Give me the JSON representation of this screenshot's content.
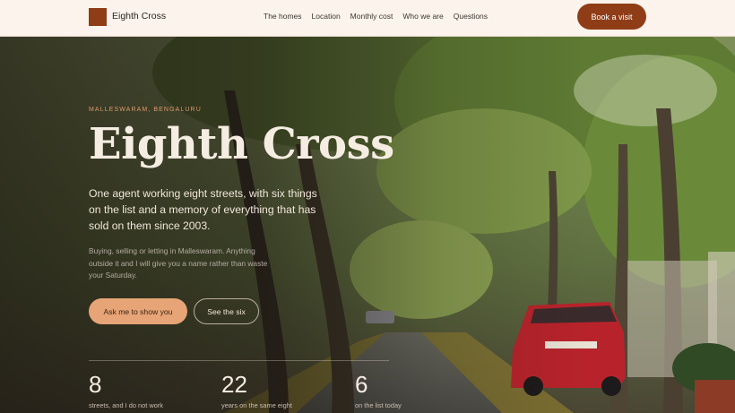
{
  "header": {
    "brand": "Eighth Cross",
    "nav": [
      "The homes",
      "Location",
      "Monthly cost",
      "Who we are",
      "Questions"
    ],
    "cta": "Book a visit"
  },
  "hero": {
    "eyebrow": "MALLESWARAM, BENGALURU",
    "title": "Eighth Cross",
    "lede": "One agent working eight streets, with six things on the list and a memory of everything that has sold on them since 2003.",
    "sub": "Buying, selling or letting in Malleswaram. Anything outside it and I will give you a name rather than waste your Saturday.",
    "primary_button": "Ask me to show you",
    "secondary_button": "See the six"
  },
  "stats": [
    {
      "value": "8",
      "label": "streets, and I do not work"
    },
    {
      "value": "22",
      "label": "years on the same eight"
    },
    {
      "value": "6",
      "label": "on the list today"
    }
  ],
  "colors": {
    "accent": "#8f3d17",
    "button_primary": "#e7a476",
    "header_bg": "#fbf3ec"
  }
}
